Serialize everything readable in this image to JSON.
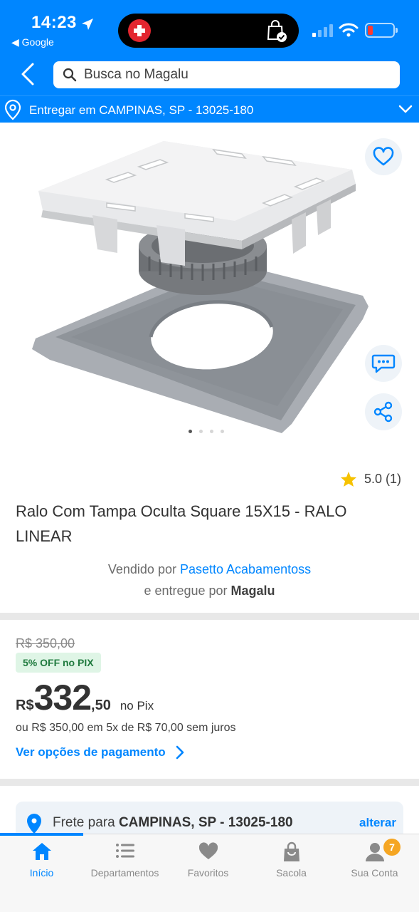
{
  "status_bar": {
    "time": "14:23",
    "back_app": "◀ Google",
    "battery_color": "#ff3b30"
  },
  "colors": {
    "brand_blue": "#0086ff",
    "discount_green": "#1f7a3e",
    "star": "#f6c200",
    "badge_orange": "#f5a623"
  },
  "header": {
    "back_icon": "chevron-left-icon",
    "search_placeholder": "Busca no Magalu",
    "search_icon": "search-icon"
  },
  "delivery_bar": {
    "text": "Entregar em CAMPINAS, SP - 13025-180",
    "icon": "location-pin-icon",
    "chevron": "chevron-down-icon"
  },
  "gallery": {
    "image": "drain-with-hidden-cover-product-image",
    "dots": [
      {
        "active": true
      },
      {
        "active": false
      },
      {
        "active": false
      },
      {
        "active": false
      }
    ],
    "actions": [
      "heart-icon",
      "chat-icon",
      "share-icon"
    ]
  },
  "product": {
    "rating": "5.0 (1)",
    "title": "Ralo Com Tampa Oculta Square 15X15 - RALO LINEAR",
    "sold_by_prefix": "Vendido por",
    "seller": "Pasetto Acabamentoss",
    "delivered_by_prefix": "e entregue por",
    "delivered_by": "Magalu"
  },
  "price": {
    "old": "R$ 350,00",
    "discount_badge": "5% OFF no PIX",
    "currency": "R$",
    "integer": "332",
    "cents": ",50",
    "method": "no Pix",
    "installments": "ou R$ 350,00 em 5x de R$ 70,00 sem juros",
    "payment_options_link": "Ver opções de pagamento"
  },
  "shipping": {
    "prefix": "Frete para",
    "place": "CAMPINAS, SP - 13025-180",
    "change": "alterar"
  },
  "tabbar": {
    "items": [
      {
        "label": "Início",
        "icon": "home-icon",
        "active": true
      },
      {
        "label": "Departamentos",
        "icon": "list-icon",
        "active": false
      },
      {
        "label": "Favoritos",
        "icon": "heart-icon",
        "active": false
      },
      {
        "label": "Sacola",
        "icon": "bag-icon",
        "active": false
      },
      {
        "label": "Sua Conta",
        "icon": "user-icon",
        "active": false,
        "badge": "7"
      }
    ]
  }
}
